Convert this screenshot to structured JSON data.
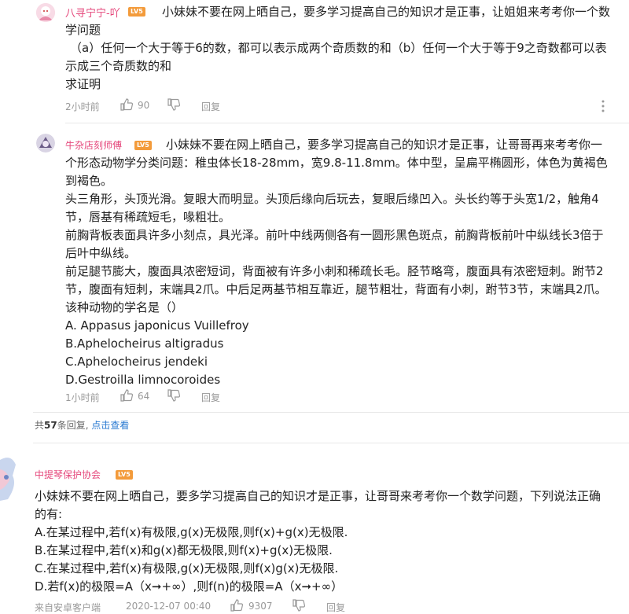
{
  "comments": [
    {
      "user": "八寻宁宁-吖",
      "level": "LV5",
      "lines": [
        "小妹妹不要在网上晒自己，要多学习提高自己的知识才是正事，让姐姐来考考你一个数",
        "学问题",
        "（a）任何一个大于等于6的数，都可以表示成两个奇质数的和（b）任何一个大于等于9之奇数都可以表",
        "示成三个奇质数的和",
        "求证明"
      ],
      "time": "2小时前",
      "likes": "90",
      "reply_label": "回复"
    },
    {
      "user": "牛杂店刻师傅",
      "level": "LV5",
      "lines": [
        "小妹妹不要在网上晒自己，要多学习提高自己的知识才是正事，让哥哥再来考考你一",
        "个形态动物学分类问题：稚虫体长18-28mm，宽9.8-11.8mm。体中型，呈扁平椭圆形，体色为黄褐色",
        "到褐色。",
        "头三角形，头顶光滑。复眼大而明显。头顶后缘向后玩去，复眼后缘凹入。头长约等于头宽1/2，触角4",
        "节，唇基有稀疏短毛，喙粗壮。",
        "前胸背板表面具许多小刻点，具光泽。前叶中线两侧各有一圆形黑色斑点，前胸背板前叶中纵线长3倍于",
        "后叶中纵线。",
        "前足腿节膨大，腹面具浓密短词，背面被有许多小刺和稀疏长毛。胫节略弯，腹面具有浓密短刺。跗节2",
        "节，腹面有短刺，末端具2爪。中后足两基节相互靠近，腿节粗壮，背面有小刺，跗节3节，末端具2爪。",
        "该种动物的学名是（）",
        "A. Appasus japonicus Vuillefroy",
        "B.Aphelocheirus altigradus",
        "C.Aphelocheirus jendeki",
        "D.Gestroilla limnocoroides"
      ],
      "time": "1小时前",
      "likes": "64",
      "reply_label": "回复"
    }
  ],
  "reply_summary": {
    "prefix": "共",
    "count": "57",
    "suffix": "条回复,",
    "link": "点击查看"
  },
  "main_comment": {
    "user": "中提琴保护协会",
    "level": "LV5",
    "lines": [
      "小妹妹不要在网上晒自己，要多学习提高自己的知识才是正事，让哥哥来考考你一个数学问题，下列说法正确",
      "的有:",
      "A.在某过程中,若f(x)有极限,g(x)无极限,则f(x)+g(x)无极限.",
      "B.在某过程中,若f(x)和g(x)都无极限,则f(x)+g(x)无极限.",
      "C.在某过程中,若f(x)有极限,g(x)无极限,则f(x)g(x)无极限.",
      "D.若f(x)的极限=A（x➞+∞）,则f(n)的极限=A（x➞+∞）"
    ],
    "source": "来自安卓客户端",
    "time": "2020-12-07 00:40",
    "likes": "9307",
    "reply_label": "回复"
  },
  "colors": {
    "username": "#e5477b",
    "level_badge": "#f39b3b",
    "link": "#2a7ad2",
    "meta": "#999999"
  }
}
